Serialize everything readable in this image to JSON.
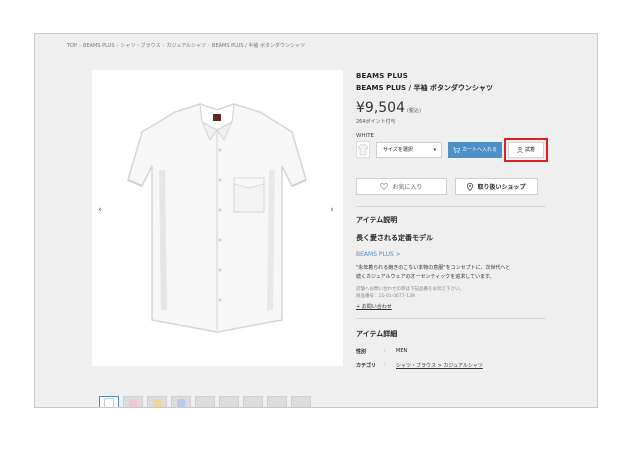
{
  "breadcrumb": [
    "TOP",
    "BEAMS PLUS",
    "シャツ・ブラウス",
    "カジュアルシャツ",
    "BEAMS PLUS / 半袖 ボタンダウンシャツ"
  ],
  "product": {
    "brand": "BEAMS PLUS",
    "name": "BEAMS PLUS / 半袖 ボタンダウンシャツ",
    "price": "¥9,504",
    "tax": "(税込)",
    "points": "264ポイント付与",
    "color": "WHITE",
    "size_placeholder": "サイズを選択",
    "cart_label": "カートへ入れる",
    "try_label": "試着",
    "favorite_label": "お気に入り",
    "shop_label": "取り扱いショップ"
  },
  "description": {
    "title": "アイテム説明",
    "catch": "長く愛される定番モデル",
    "brand_link": "BEAMS PLUS >",
    "body_line1": "\"永年着られる飽きのこない本物の意服\"をコンセプトに、次世代へと",
    "body_line2": "続くカジュアルウェアのオーセンティックを追求しています。",
    "note_line1": "店舗へお問い合わせの際は下記品番をお伝え下さい。",
    "note_line2": "商品番号：11-01-0677-139",
    "contact": "+ お問い合わせ"
  },
  "details": {
    "title": "アイテム詳細",
    "gender_key": "性別",
    "gender_value": "MEN",
    "category_key": "カテゴリ",
    "category_value": "シャツ・ブラウス > カジュアルシャツ",
    "separator": ":"
  },
  "thumb_colors": [
    "#ffffff",
    "#f1c8d2",
    "#f0d79a",
    "#b9c9ea",
    "#dcdcdc",
    "#dcdcdc",
    "#dcdcdc",
    "#dcdcdc",
    "#dcdcdc"
  ],
  "icons": {
    "prev": "chevron-left-icon",
    "next": "chevron-right-icon",
    "cart": "cart-icon",
    "try": "person-icon",
    "fav": "heart-icon",
    "shop": "location-pin-icon"
  }
}
